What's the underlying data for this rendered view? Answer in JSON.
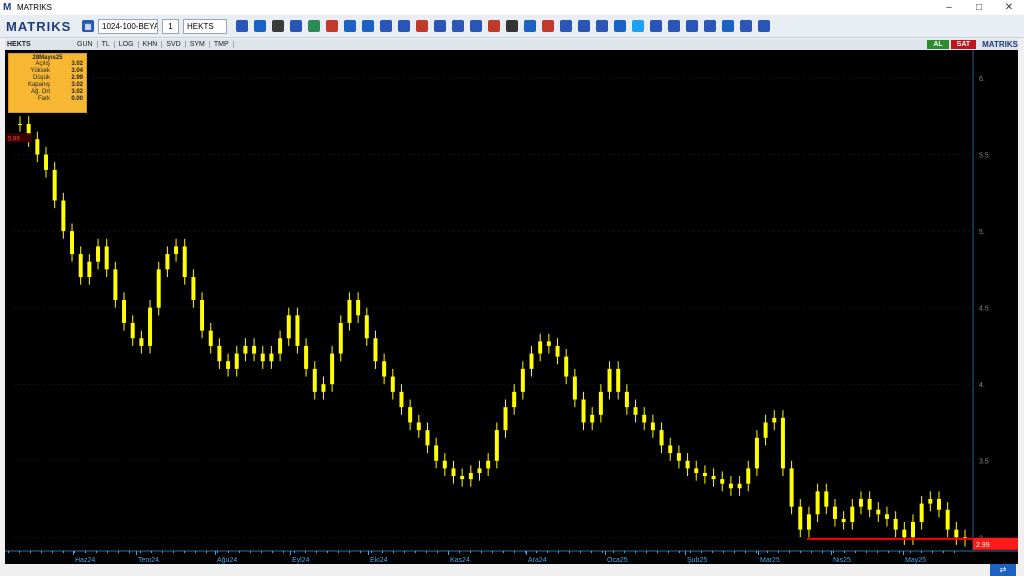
{
  "window": {
    "title": "MATRIKS",
    "logo": "M"
  },
  "toolbar": {
    "brand": "MATRIKS",
    "layout_combo": "1024-100-BEYA",
    "slot_number": "1",
    "symbol_combo": "HEKTS",
    "icon_buttons": [
      "save-icon",
      "zoom-icon",
      "cursor-icon",
      "bar-chart-icon",
      "chart-type-icon",
      "color-icon",
      "indicator-icon",
      "draw-icon",
      "text-icon",
      "bold-icon",
      "font-icon",
      "underline-icon",
      "info-icon",
      "table-icon",
      "trend-icon",
      "formula-icon",
      "settings-icon",
      "alert-icon",
      "copy-icon",
      "window-icon",
      "paste-icon",
      "search-icon",
      "twitter-icon",
      "share-icon",
      "layout-icon",
      "grid-icon",
      "bell-icon",
      "refresh-icon",
      "calculator-icon",
      "config-icon"
    ]
  },
  "subbar": {
    "symbol": "HEKTS",
    "tabs": [
      "GUN",
      "TL",
      "LOG",
      "KHN",
      "SVD",
      "SYM",
      "TMP"
    ],
    "al_label": "AL",
    "sat_label": "SAT",
    "brand": "MATRIKS"
  },
  "infobox": {
    "date": "28Mayıs25",
    "rows": [
      {
        "label": "Açılış",
        "value": "3.02"
      },
      {
        "label": "Yüksek",
        "value": "3.04"
      },
      {
        "label": "Düşük",
        "value": "2.99"
      },
      {
        "label": "Kapanış",
        "value": "3.02"
      },
      {
        "label": "Ağ. Ort",
        "value": "3.02"
      },
      {
        "label": "Fark",
        "value": "0.00"
      }
    ]
  },
  "chart_data": {
    "type": "candlestick",
    "y_ticks": [
      "6.",
      "5.5",
      "5.",
      "4.5",
      "4.",
      "3.5",
      "3."
    ],
    "y_tick_values": [
      6.0,
      5.5,
      5.0,
      4.5,
      4.0,
      3.5,
      3.0
    ],
    "ylim": [
      2.93,
      6.17
    ],
    "x_ticks": [
      "Haz24",
      "Tem24",
      "Ağu24",
      "Eyl24",
      "Eki24",
      "Kas24",
      "Ara24",
      "Oca25",
      "Şub25",
      "Mar25",
      "Nis25",
      "May25"
    ],
    "last_price_label": "2.99",
    "first_price_label": "5.89",
    "closes": [
      5.7,
      5.6,
      5.5,
      5.4,
      5.2,
      5.0,
      4.85,
      4.7,
      4.8,
      4.9,
      4.75,
      4.55,
      4.4,
      4.3,
      4.25,
      4.5,
      4.75,
      4.85,
      4.9,
      4.7,
      4.55,
      4.35,
      4.25,
      4.15,
      4.1,
      4.2,
      4.25,
      4.2,
      4.15,
      4.2,
      4.3,
      4.45,
      4.25,
      4.1,
      3.95,
      4.0,
      4.2,
      4.4,
      4.55,
      4.45,
      4.3,
      4.15,
      4.05,
      3.95,
      3.85,
      3.75,
      3.7,
      3.6,
      3.5,
      3.45,
      3.4,
      3.38,
      3.42,
      3.45,
      3.5,
      3.7,
      3.85,
      3.95,
      4.1,
      4.2,
      4.28,
      4.25,
      4.18,
      4.05,
      3.9,
      3.75,
      3.8,
      3.95,
      4.1,
      3.95,
      3.85,
      3.8,
      3.75,
      3.7,
      3.6,
      3.55,
      3.5,
      3.45,
      3.42,
      3.4,
      3.38,
      3.35,
      3.32,
      3.35,
      3.45,
      3.65,
      3.75,
      3.78,
      3.45,
      3.2,
      3.05,
      3.15,
      3.3,
      3.2,
      3.12,
      3.1,
      3.2,
      3.25,
      3.18,
      3.15,
      3.12,
      3.05,
      3.0,
      3.1,
      3.22,
      3.25,
      3.18,
      3.05,
      3.0,
      2.99
    ]
  },
  "colors": {
    "candle": "#ffff00",
    "price_line": "#ff0000",
    "price_label_bg": "#ff1a1a",
    "axis_text": "#888888",
    "grid": "#15243a",
    "infobox_bg": "#f7b733",
    "al": "#2e8b2e",
    "sat": "#c0161b"
  }
}
